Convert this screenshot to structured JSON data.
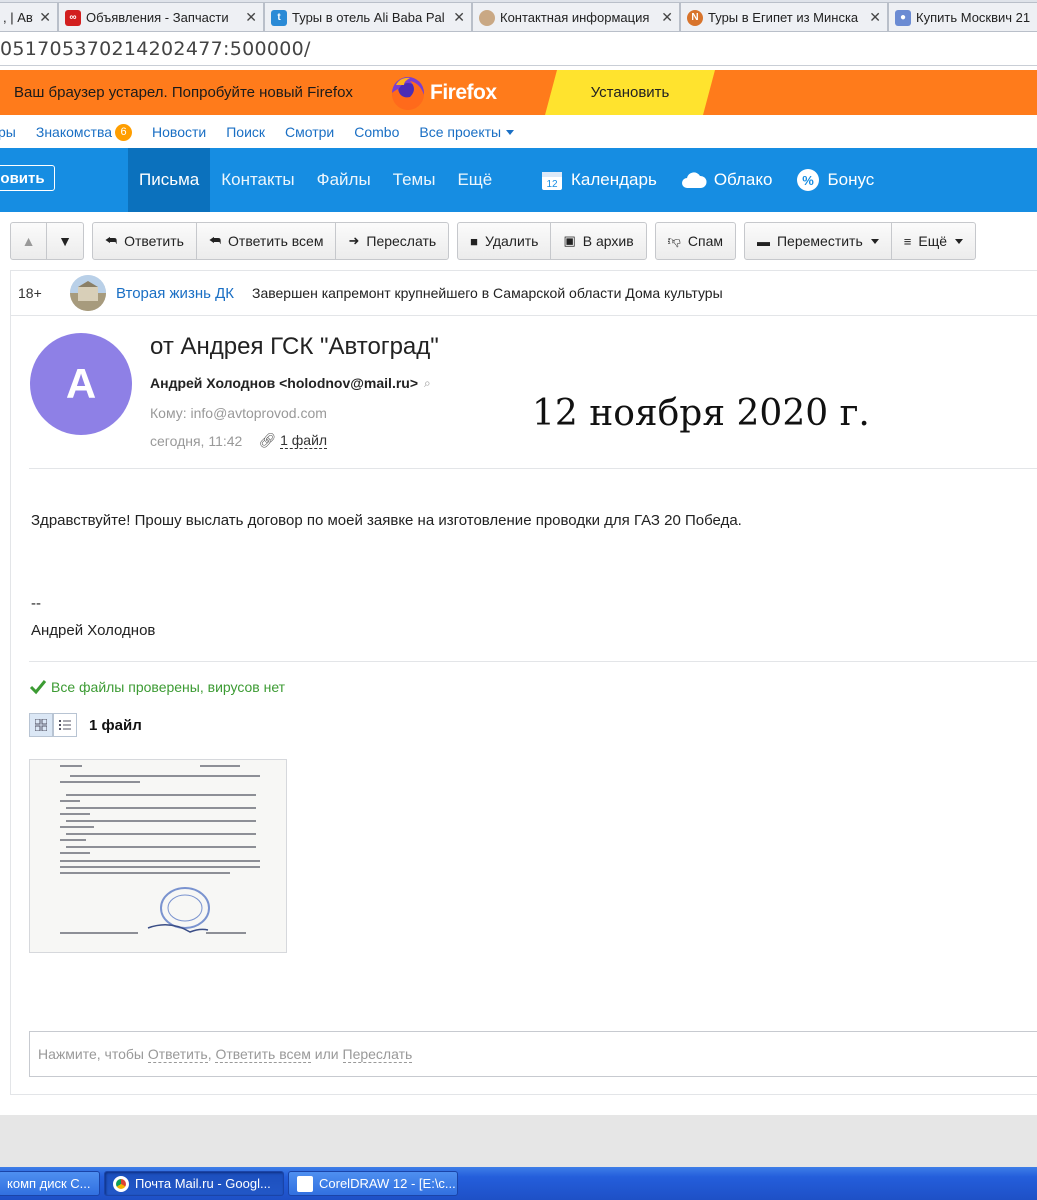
{
  "browser": {
    "tabs": [
      {
        "title": ", | Авт",
        "fav_color": "#e05a2b"
      },
      {
        "title": "Объявления - Запчасти",
        "fav_color": "#d21f1f"
      },
      {
        "title": "Туры в отель Ali Baba Pal",
        "fav_color": "#2a8ad6"
      },
      {
        "title": "Контактная информация",
        "fav_color": "#c9a884"
      },
      {
        "title": "Туры в Египет из Минска",
        "fav_color": "#d8742c"
      },
      {
        "title": "Купить Москвич 21",
        "fav_color": "#6b8bd3"
      }
    ],
    "url": "051705370214202477:500000/"
  },
  "firefox_banner": {
    "message": "Ваш браузер устарел. Попробуйте новый Firefox",
    "brand": "Firefox",
    "install_label": "Установить"
  },
  "portal": {
    "items": [
      "Игры",
      "Знакомства",
      "Новости",
      "Поиск",
      "Смотри",
      "Combo",
      "Все проекты"
    ],
    "games_visible": "ры",
    "dating_badge": "6"
  },
  "mail_nav": {
    "compose_label": "овить",
    "tabs": [
      "Письма",
      "Контакты",
      "Файлы",
      "Темы",
      "Ещё"
    ],
    "right": [
      {
        "label": "Календарь",
        "icon": "calendar-icon",
        "calendar_day": "12"
      },
      {
        "label": "Облако",
        "icon": "cloud-icon"
      },
      {
        "label": "Бонус",
        "icon": "bonus-icon"
      }
    ]
  },
  "toolbar": {
    "reply": "Ответить",
    "reply_all": "Ответить всем",
    "forward": "Переслать",
    "delete": "Удалить",
    "archive": "В архив",
    "spam": "Спам",
    "move": "Переместить",
    "more": "Ещё"
  },
  "ad": {
    "age": "18+",
    "source": "Вторая жизнь ДК",
    "text": "Завершен капремонт крупнейшего в Самарской области Дома культуры"
  },
  "message": {
    "avatar_letter": "А",
    "subject": "от Андрея ГСК \"Автоград\"",
    "from": "Андрей Холоднов <holodnov@mail.ru>",
    "to": "Кому: info@avtoprovod.com",
    "time": "сегодня, 11:42",
    "files_link": "1 файл",
    "date_stamp": "12 ноября 2020 г.",
    "body": "Здравствуйте! Прошу выслать договор по моей заявке на изготовление проводки для ГАЗ 20 Победа.",
    "sig_dash": "--",
    "sig_name": "Андрей Холоднов"
  },
  "attachments": {
    "virus_status": "Все файлы проверены, вирусов нет",
    "count_label": "1 файл"
  },
  "reply_box": {
    "prefix": "Нажмите, чтобы",
    "reply": "Ответить",
    "reply_all": "Ответить всем",
    "or": "или",
    "forward": "Переслать"
  },
  "taskbar": {
    "items": [
      {
        "label": "комп диск C...",
        "icon_color": "#e8c050"
      },
      {
        "label": "Почта Mail.ru - Googl...",
        "icon_color": "#db4437"
      },
      {
        "label": "CorelDRAW 12 - [E:\\c...",
        "icon_color": "#6fa64a"
      }
    ]
  }
}
